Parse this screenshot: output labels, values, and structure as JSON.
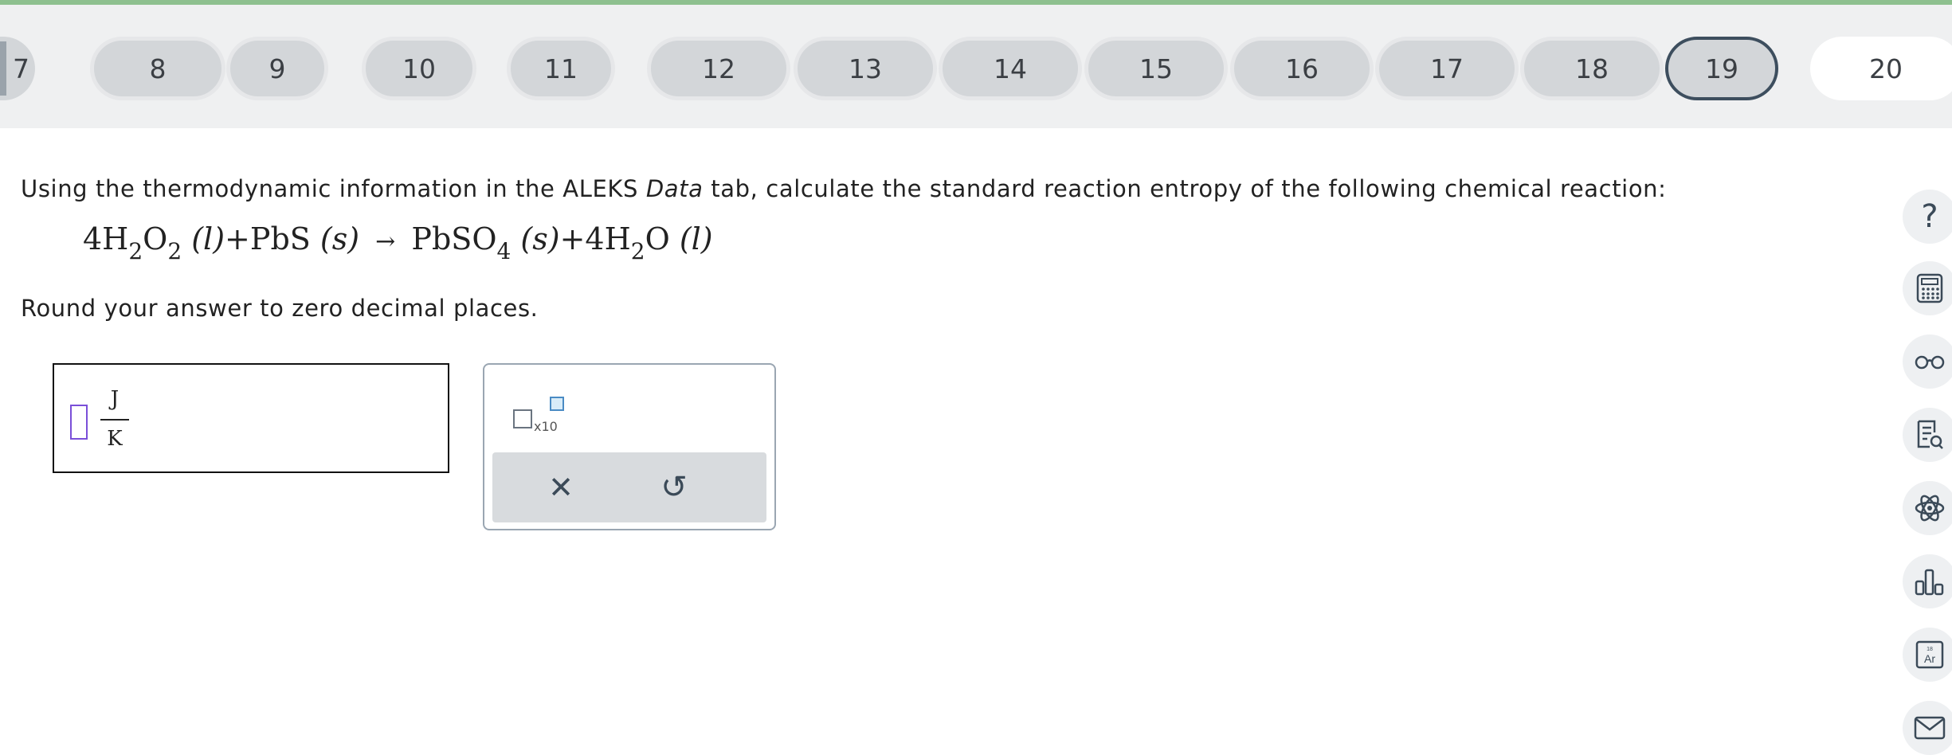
{
  "nav": {
    "questions": [
      {
        "label": "7",
        "state": "answered"
      },
      {
        "label": "8",
        "state": "answered"
      },
      {
        "label": "9",
        "state": "answered"
      },
      {
        "label": "10",
        "state": "answered"
      },
      {
        "label": "11",
        "state": "answered"
      },
      {
        "label": "12",
        "state": "answered"
      },
      {
        "label": "13",
        "state": "answered"
      },
      {
        "label": "14",
        "state": "answered"
      },
      {
        "label": "15",
        "state": "answered"
      },
      {
        "label": "16",
        "state": "answered"
      },
      {
        "label": "17",
        "state": "answered"
      },
      {
        "label": "18",
        "state": "answered"
      },
      {
        "label": "19",
        "state": "current"
      },
      {
        "label": "20",
        "state": "unanswered"
      }
    ]
  },
  "question": {
    "text_before": "Using the thermodynamic information in the ALEKS ",
    "text_italic": "Data",
    "text_after": " tab, calculate the standard reaction entropy of the following chemical reaction:",
    "equation": {
      "r1_coef": "4H",
      "r1_sub1": "2",
      "r1_mid": "O",
      "r1_sub2": "2",
      "r1_phase": "(l)",
      "plus1": "+",
      "r2": "PbS",
      "r2_phase": "(s)",
      "arrow": "→",
      "p1": "PbSO",
      "p1_sub": "4",
      "p1_phase": "(s)",
      "plus2": "+",
      "p2_coef": "4H",
      "p2_sub": "2",
      "p2_mid": "O",
      "p2_phase": "(l)"
    },
    "instruction": "Round your answer to zero decimal places."
  },
  "answer": {
    "value": "",
    "unit_numerator": "J",
    "unit_denominator": "K"
  },
  "palette": {
    "sci_label": "x10",
    "clear_symbol": "✕",
    "undo_symbol": "↺"
  },
  "sidebar": {
    "help_symbol": "?"
  },
  "colors": {
    "accent_bar": "#8ec08f",
    "current_pill_border": "#3d4e5e",
    "input_cursor": "#7a4fd8"
  }
}
